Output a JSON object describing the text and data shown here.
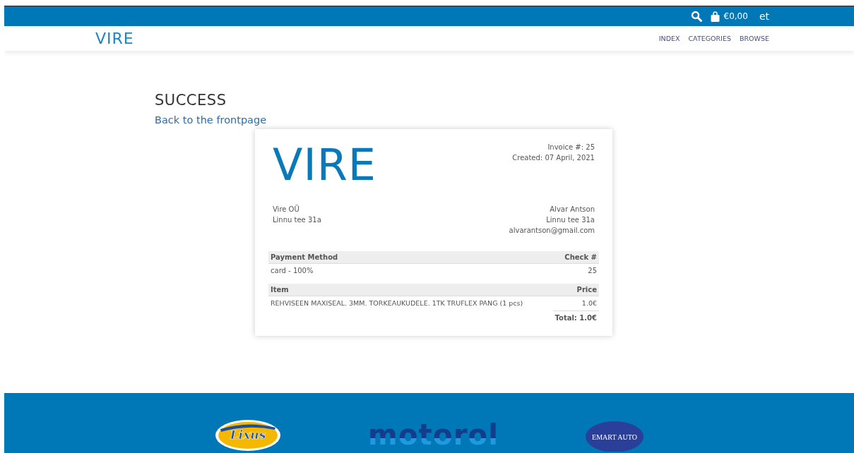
{
  "top_bar": {
    "cart_total": "€0,00",
    "language": "et"
  },
  "nav": {
    "logo": "VIRE",
    "links": [
      "INDEX",
      "CATEGORIES",
      "BROWSE"
    ]
  },
  "heading": "SUCCESS",
  "back_link": "Back to the frontpage",
  "invoice": {
    "logo": "VIRE",
    "number": "Invoice #: 25",
    "created": "Created: 07 April, 2021",
    "seller": [
      "Vire OÜ",
      "Linnu tee 31a"
    ],
    "buyer": [
      "Alvar Antson",
      "Linnu tee 31a",
      "alvarantson@gmail.com"
    ],
    "payment_header": [
      "Payment Method",
      "Check #"
    ],
    "payment_row": [
      "card - 100%",
      "25"
    ],
    "items_header": [
      "Item",
      "Price"
    ],
    "items": [
      {
        "name": "REHVISEEN MAXISEAL. 3MM. TORKEAUKUDELE. 1TK TRUFLEX PANG (1 pcs)",
        "price": "1.0€"
      }
    ],
    "total": "Total: 1.0€"
  },
  "footer_logos": [
    {
      "kind": "oval",
      "text": "Lixus"
    },
    {
      "kind": "wordmark",
      "text": "motorol"
    },
    {
      "kind": "badge",
      "text": "EMART AUTO"
    }
  ]
}
